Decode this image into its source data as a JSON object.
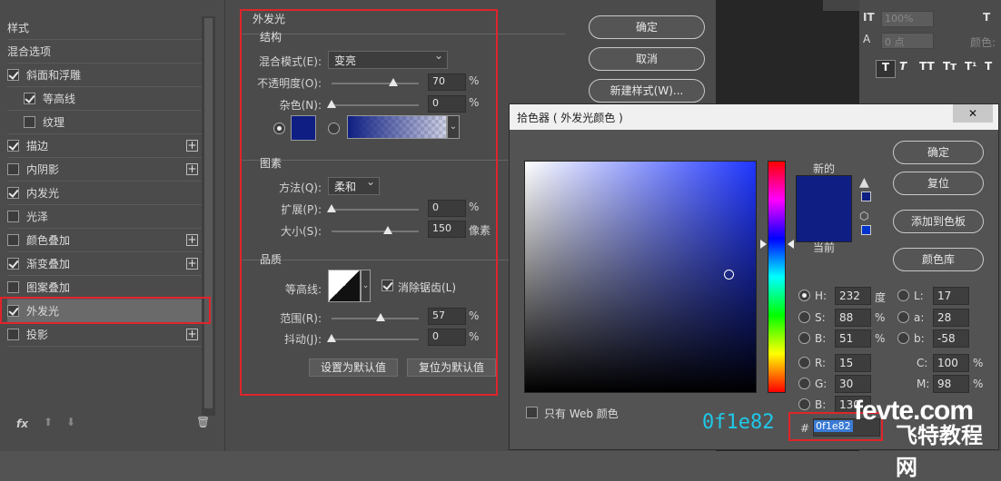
{
  "left_panel": {
    "title": "样式",
    "items": [
      {
        "label": "混合选项",
        "checkbox": false,
        "checked": false,
        "plus": false
      },
      {
        "label": "斜面和浮雕",
        "checkbox": true,
        "checked": true,
        "plus": false
      },
      {
        "label": "等高线",
        "checkbox": true,
        "checked": true,
        "plus": false
      },
      {
        "label": "纹理",
        "checkbox": true,
        "checked": false,
        "plus": false
      },
      {
        "label": "描边",
        "checkbox": true,
        "checked": true,
        "plus": true
      },
      {
        "label": "内阴影",
        "checkbox": true,
        "checked": false,
        "plus": true
      },
      {
        "label": "内发光",
        "checkbox": true,
        "checked": true,
        "plus": false
      },
      {
        "label": "光泽",
        "checkbox": true,
        "checked": false,
        "plus": false
      },
      {
        "label": "颜色叠加",
        "checkbox": true,
        "checked": false,
        "plus": true
      },
      {
        "label": "渐变叠加",
        "checkbox": true,
        "checked": true,
        "plus": true
      },
      {
        "label": "图案叠加",
        "checkbox": true,
        "checked": false,
        "plus": false
      },
      {
        "label": "外发光",
        "checkbox": true,
        "checked": true,
        "plus": false
      },
      {
        "label": "投影",
        "checkbox": true,
        "checked": false,
        "plus": true
      }
    ],
    "footer_fx": "fx"
  },
  "outer_glow": {
    "title": "外发光",
    "structure": {
      "heading": "结构",
      "blend_mode_label": "混合模式(E):",
      "blend_mode_value": "变亮",
      "opacity_label": "不透明度(O):",
      "opacity_value": "70",
      "noise_label": "杂色(N):",
      "noise_value": "0",
      "unit_pct": "%"
    },
    "elements": {
      "heading": "图素",
      "method_label": "方法(Q):",
      "method_value": "柔和",
      "spread_label": "扩展(P):",
      "spread_value": "0",
      "size_label": "大小(S):",
      "size_value": "150",
      "size_unit": "像素"
    },
    "quality": {
      "heading": "品质",
      "contour_label": "等高线:",
      "antialias_label": "消除锯齿(L)",
      "range_label": "范围(R):",
      "range_value": "57",
      "jitter_label": "抖动(J):",
      "jitter_value": "0"
    },
    "set_default": "设置为默认值",
    "reset_default": "复位为默认值",
    "glow_color": "#0f1e82"
  },
  "main_buttons": {
    "ok": "确定",
    "cancel": "取消",
    "new_style": "新建样式(W)..."
  },
  "right_panel": {
    "size_value": "100%",
    "point_value": "0 点",
    "color_label": "颜色:"
  },
  "color_picker": {
    "title": "拾色器 ( 外发光颜色 )",
    "new_label": "新的",
    "current_label": "当前",
    "buttons": {
      "ok": "确定",
      "reset": "复位",
      "add_swatch": "添加到色板",
      "libraries": "颜色库"
    },
    "web_only_label": "只有 Web 颜色",
    "fields": {
      "H": "232",
      "S": "88",
      "B_hsb": "51",
      "R": "15",
      "G": "30",
      "B_rgb": "130",
      "L": "17",
      "a": "28",
      "b": "-58",
      "C": "100",
      "M": "98"
    },
    "units": {
      "deg": "度",
      "pct": "%"
    },
    "hex_prefix": "#",
    "hex_value": "0f1e82",
    "big_hex": "0f1e82"
  },
  "watermark": {
    "site": "fevte.com",
    "name": "飞特教程网"
  }
}
